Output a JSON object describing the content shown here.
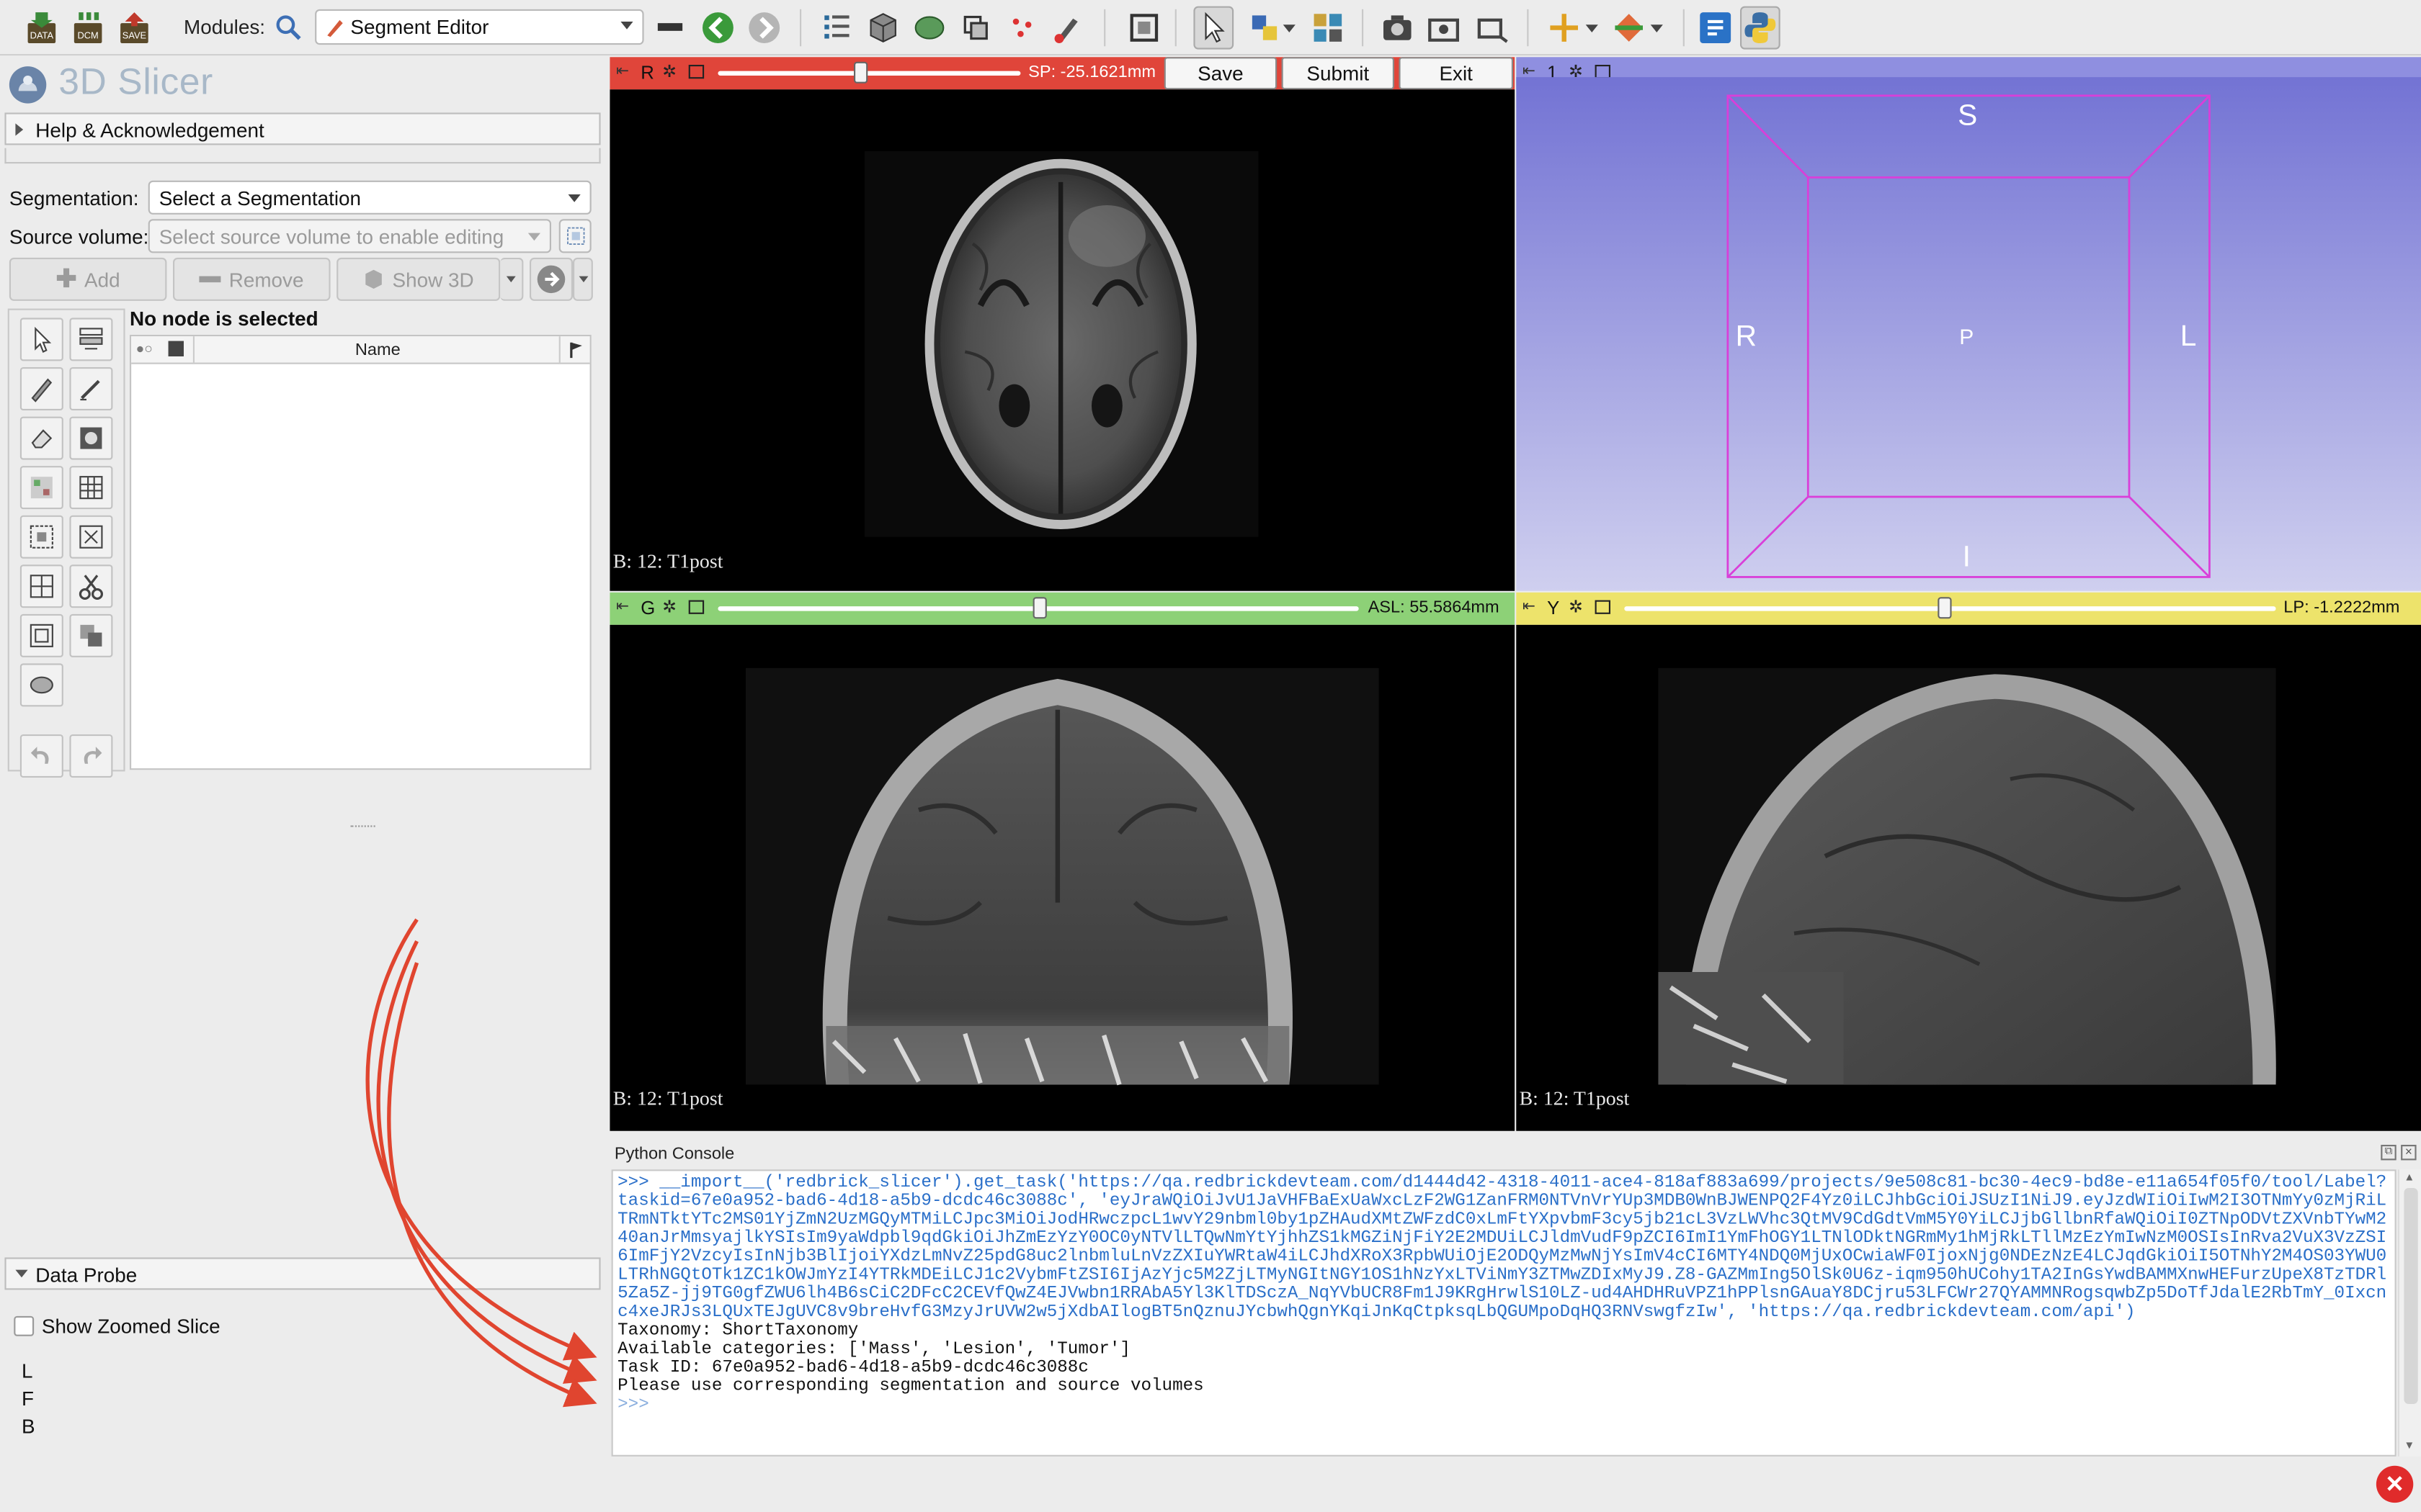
{
  "toolbar": {
    "data_label": "DATA",
    "dcm_label": "DCM",
    "save_label": "SAVE",
    "modules_label": "Modules:",
    "module_selected": "Segment Editor"
  },
  "left_panel": {
    "app_title": "3D Slicer",
    "help_label": "Help & Acknowledgement",
    "segmentation_label": "Segmentation:",
    "segmentation_value": "Select a Segmentation",
    "source_volume_label": "Source volume:",
    "source_volume_value": "Select source volume to enable editing",
    "add_label": "Add",
    "remove_label": "Remove",
    "show3d_label": "Show 3D",
    "no_node_label": "No node is selected",
    "table_name_header": "Name",
    "data_probe_label": "Data Probe",
    "show_zoomed_label": "Show Zoomed Slice",
    "probe_l": "L",
    "probe_f": "F",
    "probe_b": "B"
  },
  "views": {
    "red": {
      "letter": "R",
      "coord": "SP: -25.1621mm",
      "slider_fraction": 0.47,
      "label": "B: 12: T1post",
      "color": "#e0453a"
    },
    "threed": {
      "number": "1",
      "color": "#8f8fe0",
      "S": "S",
      "R": "R",
      "P": "P",
      "L": "L",
      "I": "I"
    },
    "green": {
      "letter": "G",
      "coord": "ASL: 55.5864mm",
      "slider_fraction": 0.5,
      "label": "B: 12: T1post",
      "color": "#8dd177"
    },
    "yellow": {
      "letter": "Y",
      "coord": "LP: -1.2222mm",
      "slider_fraction": 0.49,
      "label": "B: 12: T1post",
      "color": "#ede36b"
    }
  },
  "header_buttons": {
    "save": "Save",
    "submit": "Submit",
    "exit": "Exit"
  },
  "console": {
    "title": "Python Console",
    "command": ">>> __import__('redbrick_slicer').get_task('https://qa.redbrickdevteam.com/d1444d42-4318-4011-ace4-818af883a699/projects/9e508c81-bc30-4ec9-bd8e-e11a654f05f0/tool/Label?taskid=67e0a952-bad6-4d18-a5b9-dcdc46c3088c', 'eyJraWQiOiJvU1JaVHFBaExUaWxcLzF2WG1ZanFRM0NTVnVrYUp3MDB0WnBJWENPQ2F4Yz0iLCJhbGciOiJSUzI1NiJ9.eyJzdWIiOiIwM2I3OTNmYy0zMjRiLTRmNTktYTc2MS01YjZmN2UzMGQyMTMiLCJpc3MiOiJodHRwczpcL1wvY29nbml0by1pZHAudXMtZWFzdC0xLmFtYXpvbmF3cy5jb21cL3VzLWVhc3QtMV9CdGdtVmM5Y0YiLCJjbGllbnRfaWQiOiI0ZTNpODVtZXVnbTYwM240anJrMmsyajlkYSIsIm9yaWdpbl9qdGkiOiJhZmEzYzY0OC0yNTVlLTQwNmYtYjhhZS1kMGZiNjFiY2E2MDUiLCJldmVudF9pZCI6ImI1YmFhOGY1LTNlODktNGRmMy1hMjRkLTllMzEzYmIwNzM0OSIsInRva2VuX3VzZSI6ImFjY2VzcyIsInNjb3BlIjoiYXdzLmNvZ25pdG8uc2lnbmluLnVzZXIuYWRtaW4iLCJhdXRoX3RpbWUiOjE2ODQyMzMwNjYsImV4cCI6MTY4NDQ0MjUxOCwiaWF0IjoxNjg0NDEzNzE4LCJqdGkiOiI5OTNhY2M4OS03YWU0LTRhNGQtOTk1ZC1kOWJmYzI4YTRkMDEiLCJ1c2VybmFtZSI6IjAzYjc5M2ZjLTMyNGItNGY1OS1hNzYxLTViNmY3ZTMwZDIxMyJ9.Z8-GAZMmIng5OlSk0U6z-iqm950hUCohy1TA2InGsYwdBAMMXnwHEFurzUpeX8TzTDRl5Za5Z-jj9TG0gfZWU6lh4B6sCiC2DFcC2CEVfQwZ4EJVwbn1RRAbA5Yl3KlTDSczA_NqYVbUCR8Fm1J9KRgHrwlS10LZ-ud4AHDHRuVPZ1hPPlsnGAuaY8DCjru53LFCWr27QYAMMNRogsqwbZp5DoTfJdalE2RbTmY_0Ixcnc4xeJRJs3LQUxTEJgUVC8v9breHvfG3MzyJrUVW2w5jXdbAIlogBT5nQznuJYcbwhQgnYKqiJnKqCtpksqLbQGUMpoDqHQ3RNVswgfzIw', 'https://qa.redbrickdevteam.com/api')",
    "output_lines": [
      "Taxonomy: ShortTaxonomy",
      "Available categories: ['Mass', 'Lesion', 'Tumor']",
      "Task ID: 67e0a952-bad6-4d18-a5b9-dcdc46c3088c",
      "Please use corresponding segmentation and source volumes"
    ],
    "prompt": ">>>"
  },
  "annotation_color": "#e0452f"
}
